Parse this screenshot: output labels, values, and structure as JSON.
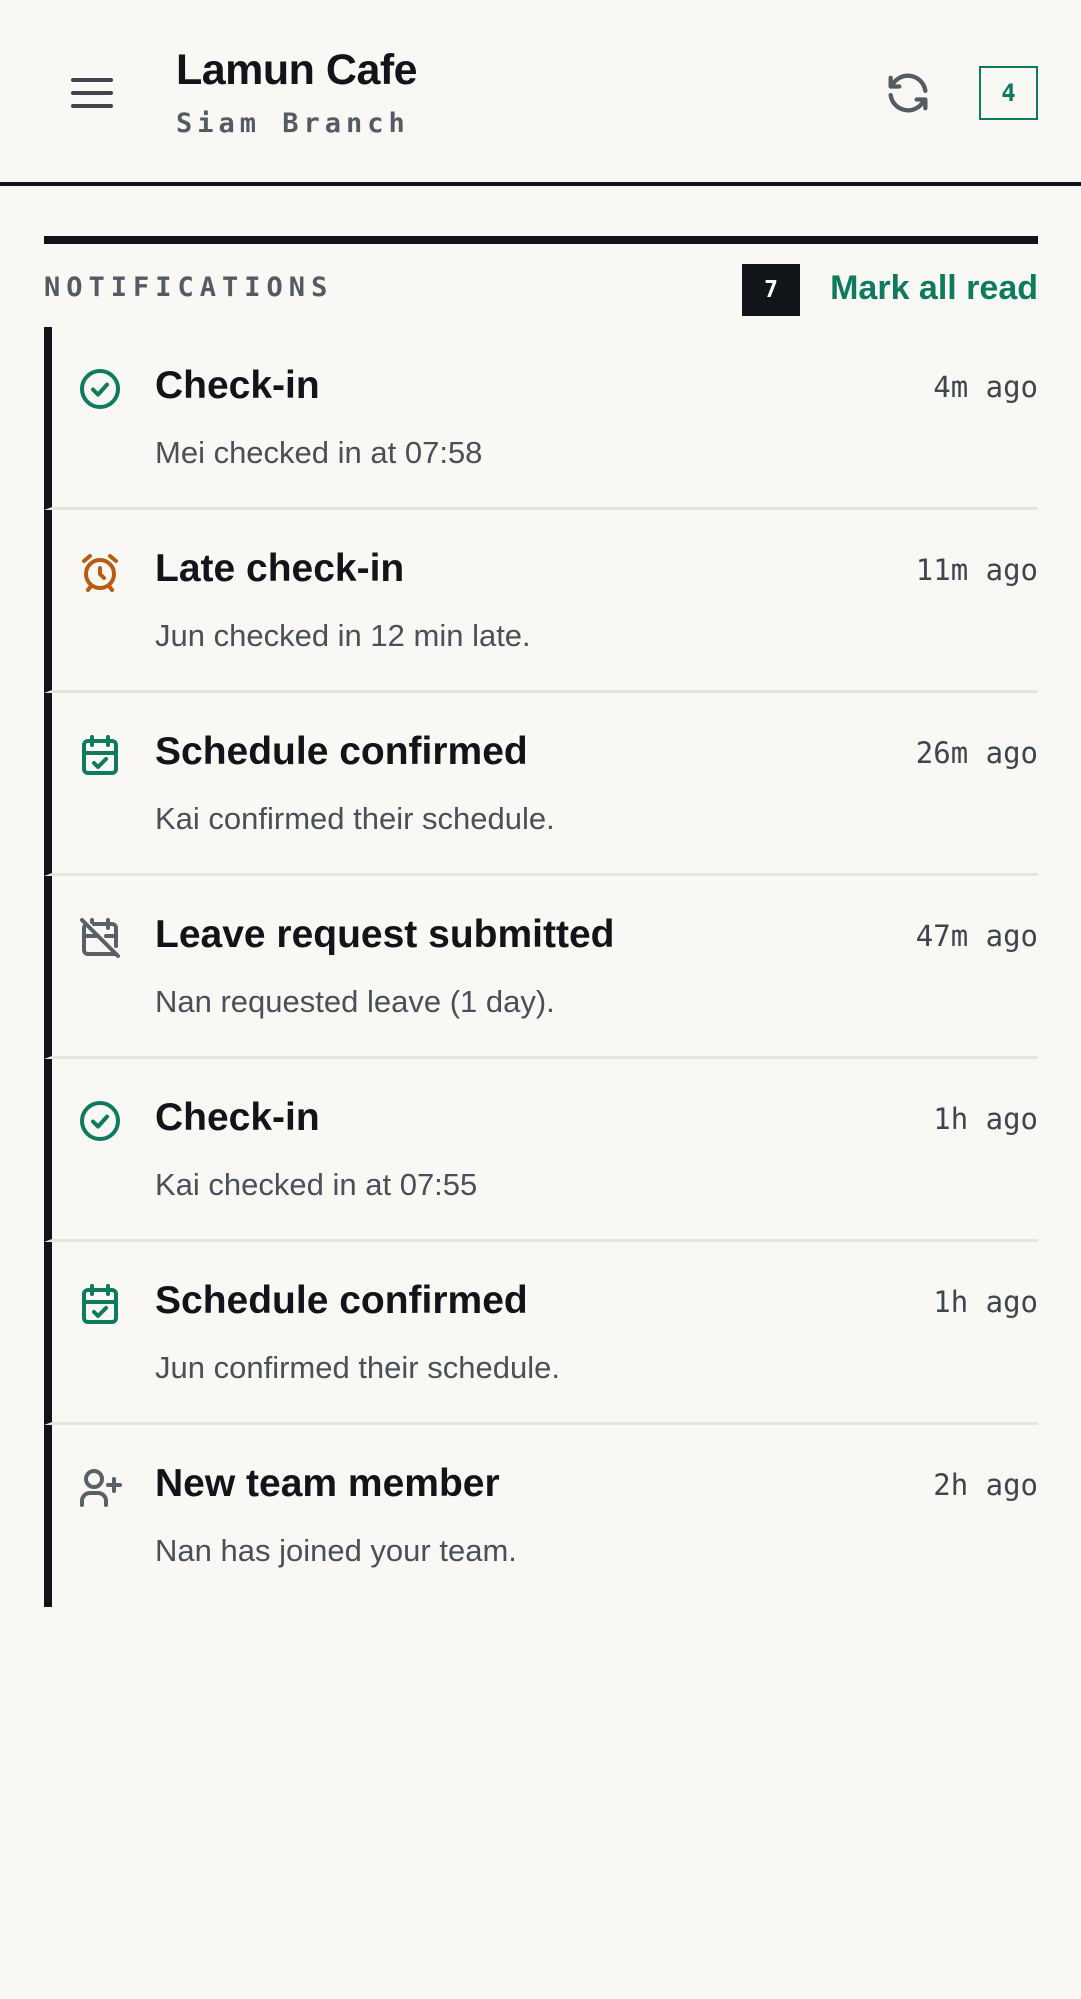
{
  "app": {
    "title": "Lamun Cafe",
    "subtitle": "Siam Branch",
    "header_badge": "4",
    "menu_icon": "menu-icon",
    "refresh_icon": "refresh-icon"
  },
  "notifications": {
    "section_label": "NOTIFICATIONS",
    "count": "7",
    "mark_all_label": "Mark all read",
    "items": [
      {
        "icon": "check-circle-icon",
        "title": "Check-in",
        "time": "4m ago",
        "body": "Mei checked in at 07:58"
      },
      {
        "icon": "alarm-clock-icon",
        "title": "Late check-in",
        "time": "11m ago",
        "body": "Jun checked in 12 min late."
      },
      {
        "icon": "calendar-check-icon",
        "title": "Schedule confirmed",
        "time": "26m ago",
        "body": "Kai confirmed their schedule."
      },
      {
        "icon": "calendar-off-icon",
        "title": "Leave request submitted",
        "time": "47m ago",
        "body": "Nan requested leave (1 day)."
      },
      {
        "icon": "check-circle-icon",
        "title": "Check-in",
        "time": "1h ago",
        "body": "Kai checked in at 07:55"
      },
      {
        "icon": "calendar-check-icon",
        "title": "Schedule confirmed",
        "time": "1h ago",
        "body": "Jun confirmed their schedule."
      },
      {
        "icon": "user-plus-icon",
        "title": "New team member",
        "time": "2h ago",
        "body": "Nan has joined your team."
      }
    ]
  },
  "colors": {
    "accent": "#0e7a5e",
    "warning": "#b85c12",
    "ink": "#111418",
    "muted": "#555b63",
    "background": "#f9f8f5"
  }
}
